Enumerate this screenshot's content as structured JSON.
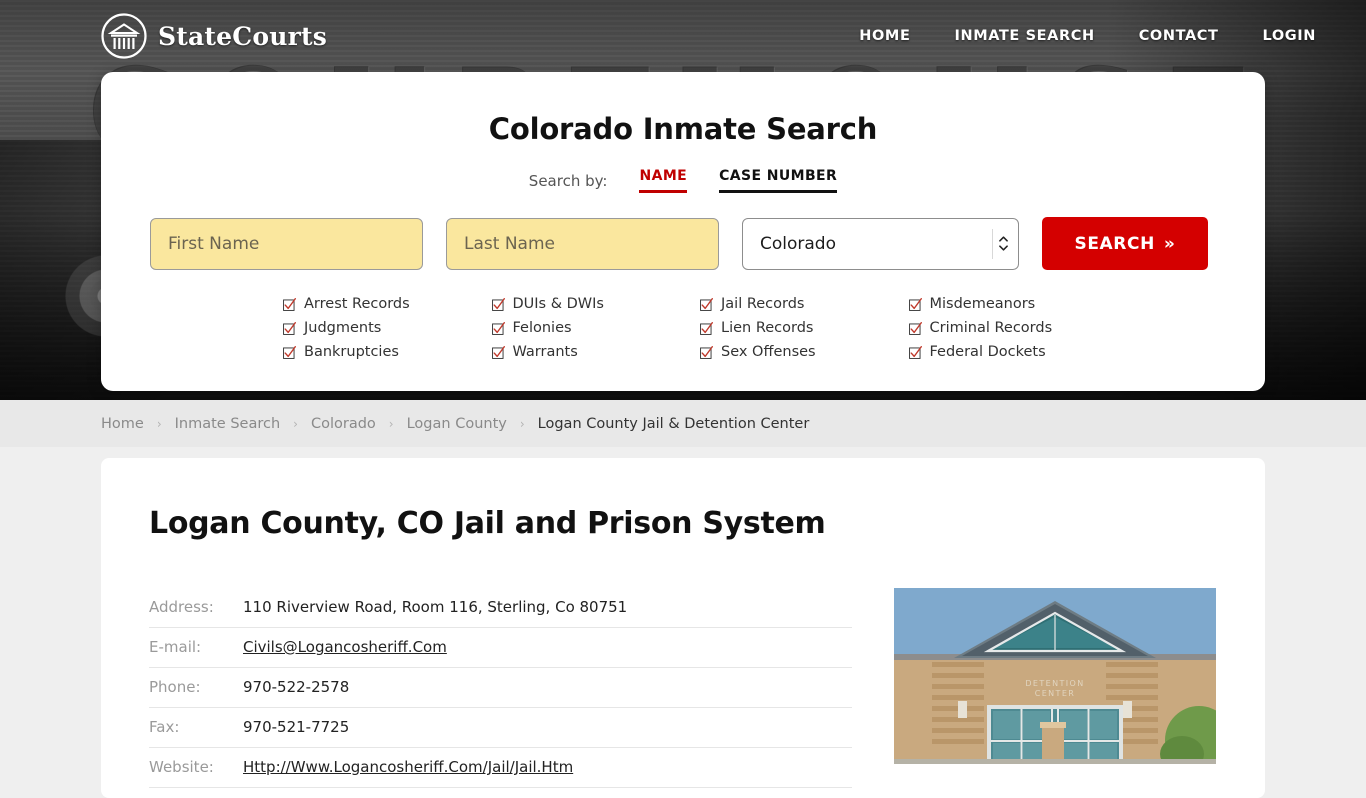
{
  "header": {
    "logo_text": "StateCourts",
    "logo_icon": "courthouse-circle-icon",
    "nav": [
      {
        "label": "HOME"
      },
      {
        "label": "INMATE SEARCH"
      },
      {
        "label": "CONTACT"
      },
      {
        "label": "LOGIN"
      }
    ]
  },
  "search": {
    "title": "Colorado Inmate Search",
    "search_by_label": "Search by:",
    "tabs": [
      {
        "label": "NAME",
        "active": true,
        "color": "#c00000"
      },
      {
        "label": "CASE NUMBER",
        "active": false,
        "color": "#111111"
      }
    ],
    "first_name_placeholder": "First Name",
    "first_name_value": "",
    "last_name_placeholder": "Last Name",
    "last_name_value": "",
    "state_selected": "Colorado",
    "search_button": "SEARCH",
    "search_button_chevrons": "»",
    "record_types": [
      "Arrest Records",
      "DUIs & DWIs",
      "Jail Records",
      "Misdemeanors",
      "Judgments",
      "Felonies",
      "Lien Records",
      "Criminal Records",
      "Bankruptcies",
      "Warrants",
      "Sex Offenses",
      "Federal Dockets"
    ]
  },
  "breadcrumb": {
    "separator": "›",
    "items": [
      {
        "label": "Home",
        "active": false
      },
      {
        "label": "Inmate Search",
        "active": false
      },
      {
        "label": "Colorado",
        "active": false
      },
      {
        "label": "Logan County",
        "active": false
      },
      {
        "label": "Logan County Jail & Detention Center",
        "active": true
      }
    ]
  },
  "content": {
    "page_title": "Logan County, CO Jail and Prison System",
    "info_rows": [
      {
        "label": "Address:",
        "value": "110 Riverview Road, Room 116, Sterling, Co 80751",
        "link": false
      },
      {
        "label": "E-mail:",
        "value": "Civils@Logancosheriff.Com",
        "link": true
      },
      {
        "label": "Phone:",
        "value": "970-522-2578",
        "link": false
      },
      {
        "label": "Fax:",
        "value": "970-521-7725",
        "link": false
      },
      {
        "label": "Website:",
        "value": "Http://Www.Logancosheriff.Com/Jail/Jail.Htm",
        "link": true
      }
    ],
    "photo_alt": "Logan County Detention Center building",
    "photo_sign_text": "DETENTION CENTER"
  },
  "colors": {
    "accent_red": "#c00000",
    "button_red": "#d40000",
    "field_yellow": "#fae79e",
    "page_background": "#efefef",
    "breadcrumb_background": "#e8e8e8"
  }
}
